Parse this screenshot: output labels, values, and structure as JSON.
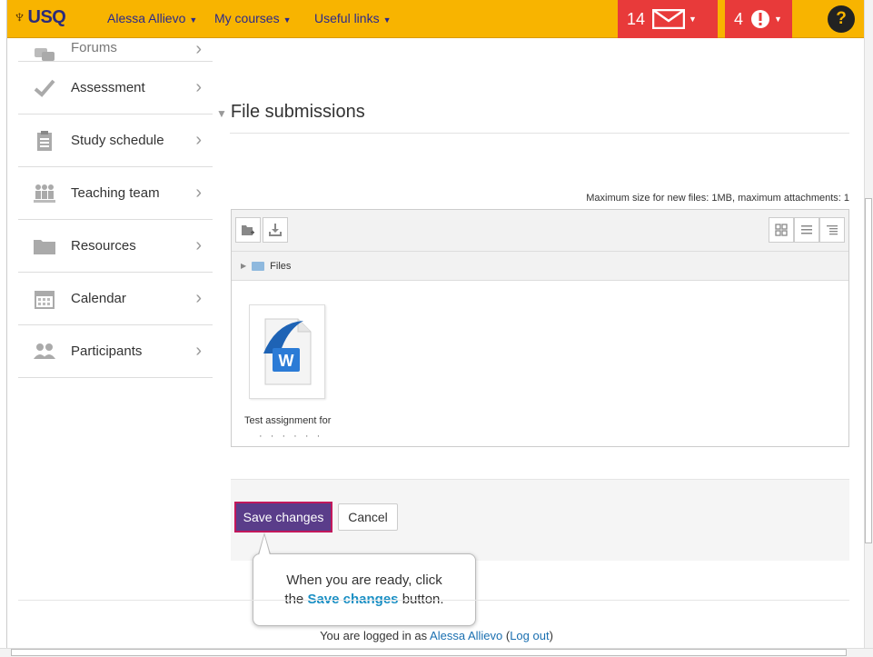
{
  "topbar": {
    "logo": "USQ",
    "user_menu": "Alessa Allievo",
    "courses_menu": "My courses",
    "links_menu": "Useful links",
    "messages_count": "14",
    "alerts_count": "4",
    "help_label": "?"
  },
  "sidebar": {
    "items": [
      {
        "label": "Forums",
        "icon": "forums-icon"
      },
      {
        "label": "Assessment",
        "icon": "check-icon"
      },
      {
        "label": "Study schedule",
        "icon": "clipboard-icon"
      },
      {
        "label": "Teaching team",
        "icon": "team-icon"
      },
      {
        "label": "Resources",
        "icon": "folder-icon"
      },
      {
        "label": "Calendar",
        "icon": "calendar-icon"
      },
      {
        "label": "Participants",
        "icon": "people-icon"
      }
    ]
  },
  "main": {
    "section_title": "File submissions",
    "max_size_note": "Maximum size for new files: 1MB, maximum attachments: 1",
    "path_label": "Files",
    "file": {
      "name": "Test assignment for",
      "name_cut": "· · · · · ·"
    }
  },
  "actions": {
    "save_label": "Save changes",
    "cancel_label": "Cancel"
  },
  "tooltip": {
    "line1": "When you are ready, click",
    "prefix": "the",
    "highlight": "Save changes",
    "suffix": "button."
  },
  "footer": {
    "prefix": "You are logged in as",
    "user": "Alessa Allievo",
    "logout": "Log out"
  },
  "colors": {
    "topbar": "#f8b400",
    "badge": "#e83a3a",
    "save_button": "#5a3d8a",
    "highlight": "#1a8fc4"
  }
}
